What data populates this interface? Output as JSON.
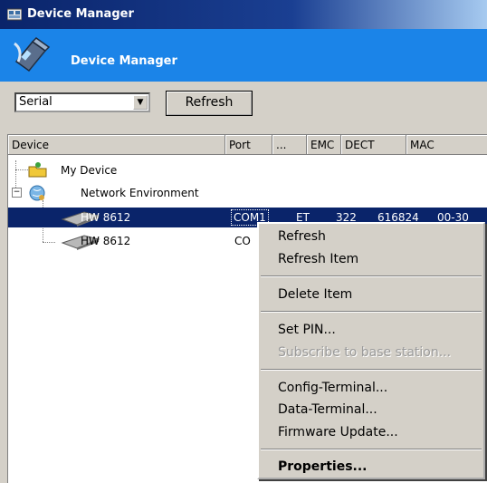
{
  "window": {
    "title": "Device Manager"
  },
  "banner": {
    "title": "Device Manager"
  },
  "toolbar": {
    "connection_type": "Serial",
    "refresh_label": "Refresh"
  },
  "columns": [
    "Device",
    "Port",
    "...",
    "EMC",
    "DECT",
    "MAC"
  ],
  "tree": {
    "my_device": "My Device",
    "network_environment": "Network Environment",
    "devices": [
      {
        "name": "HW 8612",
        "port": "COM1",
        "col3": "ET",
        "emc": "322",
        "dect": "616824",
        "mac": "00-30"
      },
      {
        "name": "HW 8612",
        "port": "CO"
      }
    ]
  },
  "context_menu": {
    "items": [
      "Refresh",
      "Refresh Item",
      "Delete Item",
      "Set PIN...",
      "Subscribe to base station...",
      "Config-Terminal...",
      "Data-Terminal...",
      "Firmware Update...",
      "Properties..."
    ]
  },
  "colors": {
    "title_bar": "#0a246a",
    "banner": "#1b84e8",
    "selection": "#0a246a",
    "face": "#d4d0c8"
  }
}
